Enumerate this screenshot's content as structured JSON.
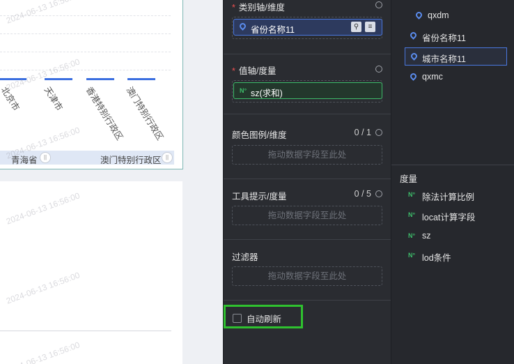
{
  "watermark": "2024-06-13 16:56:00",
  "chart": {
    "x_categories": [
      "北京市",
      "天津市",
      "香港特别行政区",
      "澳门特别行政区"
    ],
    "slider_start_label": "青海省",
    "slider_end_label": "澳门特别行政区"
  },
  "config": {
    "category_axis": {
      "title": "类别轴/维度",
      "field": "省份名称11"
    },
    "value_axis": {
      "title": "值轴/度量",
      "field": "sz(求和)"
    },
    "color_legend": {
      "title": "颜色图例/维度",
      "count": "0 / 1",
      "placeholder": "拖动数据字段至此处"
    },
    "tooltip": {
      "title": "工具提示/度量",
      "count": "0 / 5",
      "placeholder": "拖动数据字段至此处"
    },
    "filter": {
      "title": "过滤器",
      "placeholder": "拖动数据字段至此处"
    },
    "auto_refresh": {
      "label": "自动刷新",
      "checked": false
    }
  },
  "field_list": {
    "dimensions": [
      "qxdm",
      "省份名称11",
      "城市名称11",
      "qxmc"
    ],
    "selected_dimension": "城市名称11",
    "measures_title": "度量",
    "measures": [
      "除法计算比例",
      "locat计算字段",
      "sz",
      "lod条件"
    ]
  },
  "colors": {
    "accent": "#4a78e0",
    "measure": "#3dbc6a",
    "highlight": "#2fc12f",
    "required": "#f05050"
  }
}
